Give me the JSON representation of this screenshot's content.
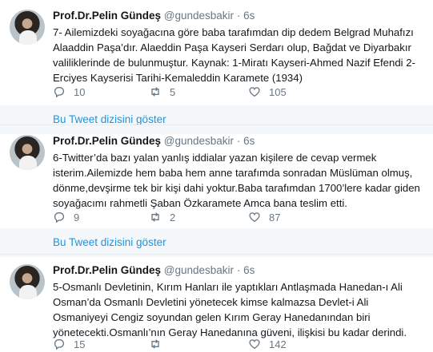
{
  "thread_label": "Bu Tweet dizisini göster",
  "tweets": [
    {
      "name": "Prof.Dr.Pelin Gündeş",
      "handle": "@gundesbakir",
      "dot": "·",
      "time": "6s",
      "text": "7- Ailemizdeki soyağacına göre baba tarafımdan dip dedem Belgrad Muhafızı Alaaddin Paşa’dır. Alaeddin Paşa Kayseri Serdarı olup, Bağdat ve Diyarbakır valiliklerinde de bulunmuştur. Kaynak: 1-Miratı Kayseri-Ahmed Nazif Efendi 2-Erciyes Kayserisi Tarihi-Kemaleddin Karamete (1934)",
      "replies": "10",
      "retweets": "5",
      "likes": "105",
      "thread": "Bu Tweet dizisini göster"
    },
    {
      "name": "Prof.Dr.Pelin Gündeş",
      "handle": "@gundesbakir",
      "dot": "·",
      "time": "6s",
      "text": "6-Twitter’da bazı yalan yanlış iddialar yazan kişilere de cevap vermek isterim.Ailemizde hem baba hem anne tarafımda sonradan Müslüman olmuş, dönme,devşirme tek bir kişi dahi yoktur.Baba tarafımdan 1700’lere kadar giden soyağacımı rahmetli Şaban Özkaramete Amca bana teslim etti.",
      "replies": "9",
      "retweets": "2",
      "likes": "87",
      "thread": "Bu Tweet dizisini göster"
    },
    {
      "name": "Prof.Dr.Pelin Gündeş",
      "handle": "@gundesbakir",
      "dot": "·",
      "time": "6s",
      "text": "5-Osmanlı Devletinin, Kırım Hanları ile yaptıkları Antlaşmada Hanedan-ı Ali Osman’da Osmanlı Devletini yönetecek kimse kalmazsa Devlet-i Ali Osmaniyeyi Cengiz soyundan gelen Kırım Geray Hanedanından biri yönetecekti.Osmanlı’nın Geray Hanedanına güveni, ilişkisi bu kadar derindi.",
      "replies": "15",
      "retweets": "",
      "likes": "142"
    }
  ],
  "icons": {
    "reply": "reply-icon",
    "retweet": "retweet-icon",
    "like": "heart-icon"
  },
  "colors": {
    "link": "#1b95e0",
    "muted": "#657786",
    "thread_bg": "#f5f8fa",
    "border": "#e6ecf0"
  }
}
